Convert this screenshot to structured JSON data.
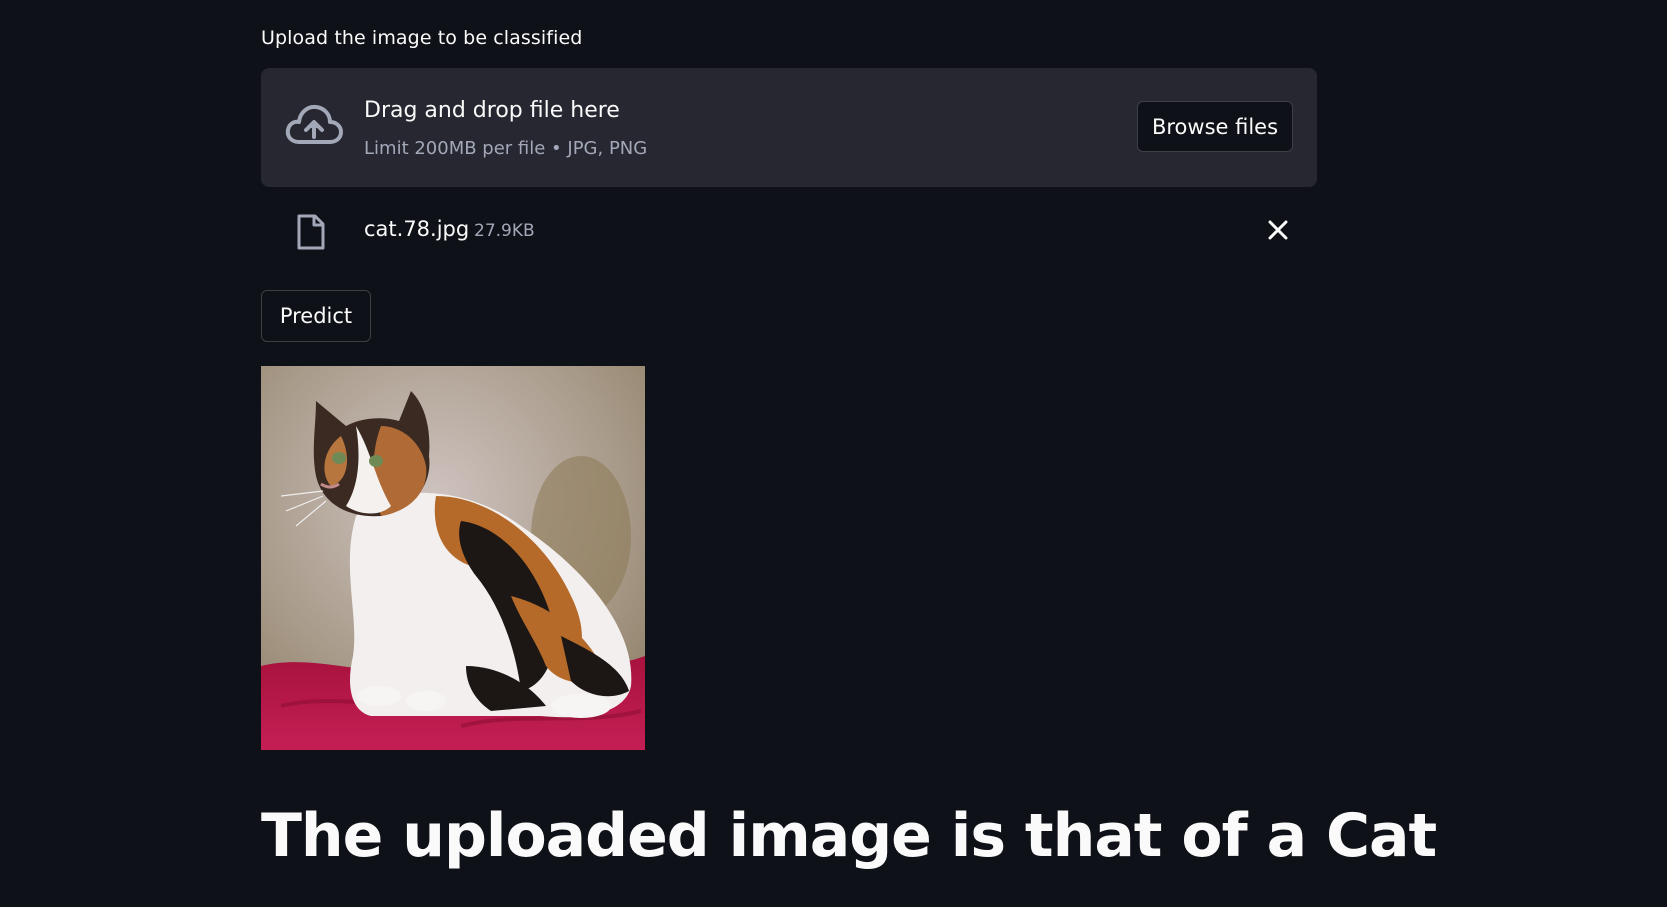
{
  "uploader": {
    "label": "Upload the image to be classified",
    "dropzone_title": "Drag and drop file here",
    "dropzone_limit": "Limit 200MB per file • JPG, PNG",
    "browse_label": "Browse files",
    "icon": "cloud-upload-icon"
  },
  "file": {
    "name": "cat.78.jpg",
    "size": "27.9KB",
    "icon": "file-icon",
    "remove_icon": "close-icon"
  },
  "predict": {
    "label": "Predict"
  },
  "image": {
    "subject": "calico-cat"
  },
  "result": {
    "text": "The uploaded image is that of a Cat"
  },
  "colors": {
    "background": "#0e1117",
    "dropzone": "#262730",
    "text": "#fafafa",
    "muted_text": "#a3a8b8",
    "blanket": "#c2184f"
  }
}
